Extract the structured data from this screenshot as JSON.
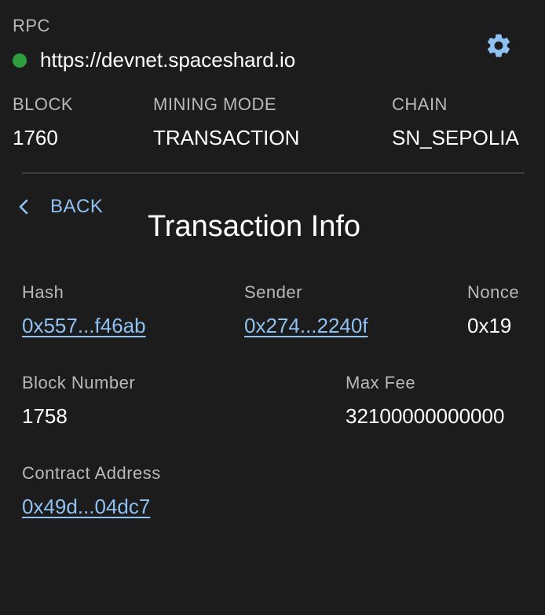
{
  "colors": {
    "background": "#1c1c1c",
    "status_dot": "#2e9e3c",
    "accent": "#8fc1f2"
  },
  "rpc": {
    "label": "RPC",
    "url": "https://devnet.spaceshard.io",
    "status_icon": "status-dot",
    "settings_icon": "gear-icon"
  },
  "stats": {
    "block": {
      "label": "BLOCK",
      "value": "1760"
    },
    "mining_mode": {
      "label": "MINING MODE",
      "value": "TRANSACTION"
    },
    "chain": {
      "label": "CHAIN",
      "value": "SN_SEPOLIA"
    }
  },
  "nav": {
    "back_label": "BACK",
    "back_icon": "chevron-left-icon"
  },
  "page": {
    "title": "Transaction Info"
  },
  "fields": {
    "hash": {
      "label": "Hash",
      "value": "0x557...f46ab"
    },
    "sender": {
      "label": "Sender",
      "value": "0x274...2240f"
    },
    "nonce": {
      "label": "Nonce",
      "value": "0x19"
    },
    "block_number": {
      "label": "Block Number",
      "value": "1758"
    },
    "max_fee": {
      "label": "Max Fee",
      "value": "32100000000000"
    },
    "contract_address": {
      "label": "Contract Address",
      "value": "0x49d...04dc7"
    }
  }
}
